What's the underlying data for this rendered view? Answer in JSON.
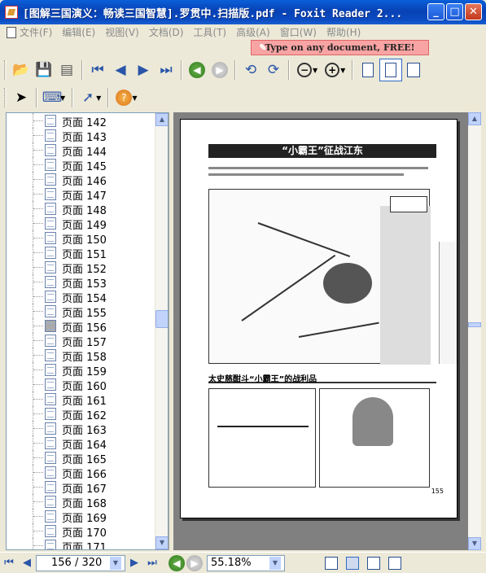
{
  "window": {
    "title": "[图解三国演义：畅读三国智慧].罗贯中.扫描版.pdf - Foxit Reader 2...",
    "min_symbol": "_",
    "max_symbol": "□",
    "close_symbol": "✕"
  },
  "menu": {
    "items": [
      "文件(F)",
      "编辑(E)",
      "视图(V)",
      "文档(D)",
      "工具(T)",
      "高级(A)",
      "窗口(W)",
      "帮助(H)"
    ]
  },
  "ad": {
    "text": "Type on any document, FREE!"
  },
  "toolbar1": {
    "icons": [
      "open-icon",
      "save-icon",
      "print-icon",
      "first-page-icon",
      "prev-page-icon",
      "next-page-icon",
      "last-page-icon",
      "back-icon",
      "forward-icon",
      "rotate-left-icon",
      "rotate-right-icon",
      "zoom-out-icon",
      "zoom-in-icon",
      "actual-size-icon",
      "fit-page-icon",
      "fit-width-icon"
    ]
  },
  "toolbar2": {
    "icons": [
      "select-arrow-icon",
      "typewriter-icon",
      "link-arrow-icon",
      "help-icon"
    ]
  },
  "sidebar": {
    "pages": [
      "页面 142",
      "页面 143",
      "页面 144",
      "页面 145",
      "页面 146",
      "页面 147",
      "页面 148",
      "页面 149",
      "页面 150",
      "页面 151",
      "页面 152",
      "页面 153",
      "页面 154",
      "页面 155",
      "页面 156",
      "页面 157",
      "页面 158",
      "页面 159",
      "页面 160",
      "页面 161",
      "页面 162",
      "页面 163",
      "页面 164",
      "页面 165",
      "页面 166",
      "页面 167",
      "页面 168",
      "页面 169",
      "页面 170",
      "页面 171"
    ],
    "current_page": "页面 156"
  },
  "document": {
    "headline": "“小霸王”征战江东",
    "section_title": "太史慈酣斗“小霸王”的战利品",
    "page_number": "155"
  },
  "statusbar": {
    "page_indicator": "156 / 320",
    "zoom": "55.18%"
  }
}
